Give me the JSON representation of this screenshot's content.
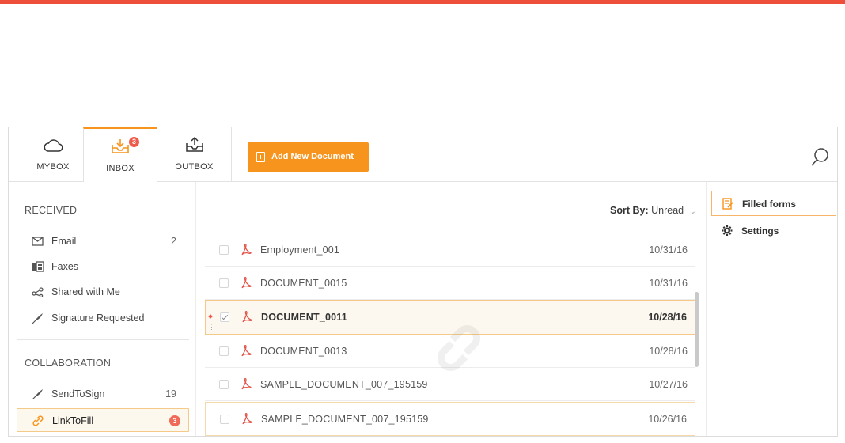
{
  "header": {
    "tabs": [
      {
        "label": "MYBOX",
        "icon": "cloud-icon"
      },
      {
        "label": "INBOX",
        "icon": "inbox-icon",
        "badge": "3"
      },
      {
        "label": "OUTBOX",
        "icon": "outbox-icon"
      }
    ],
    "add_button": "Add New Document",
    "accent": "#f7941d",
    "brand_bar": "#ee4f3b"
  },
  "sidebar": {
    "received_title": "RECEIVED",
    "received": [
      {
        "label": "Email",
        "count": "2",
        "icon": "envelope-icon"
      },
      {
        "label": "Faxes",
        "count": "",
        "icon": "fax-icon"
      },
      {
        "label": "Shared with Me",
        "count": "",
        "icon": "share-icon"
      },
      {
        "label": "Signature Requested",
        "count": "",
        "icon": "quill-icon"
      }
    ],
    "collab_title": "COLLABORATION",
    "collab": [
      {
        "label": "SendToSign",
        "count": "19",
        "icon": "quill-icon"
      },
      {
        "label": "LinkToFill",
        "badge": "3",
        "icon": "link-icon"
      }
    ]
  },
  "list": {
    "sort_label": "Sort By:",
    "sort_value": "Unread",
    "rows": [
      {
        "name": "Employment_001",
        "date": "10/31/16"
      },
      {
        "name": "DOCUMENT_0015",
        "date": "10/31/16"
      },
      {
        "name": "DOCUMENT_0011",
        "date": "10/28/16"
      },
      {
        "name": "DOCUMENT_0013",
        "date": "10/28/16"
      },
      {
        "name": "SAMPLE_DOCUMENT_007_195159",
        "date": "10/27/16"
      },
      {
        "name": "SAMPLE_DOCUMENT_007_195159",
        "date": "10/26/16"
      }
    ]
  },
  "right_panel": {
    "items": [
      {
        "label": "Filled forms",
        "icon": "filled-forms-icon"
      },
      {
        "label": "Settings",
        "icon": "gear-icon"
      }
    ]
  }
}
